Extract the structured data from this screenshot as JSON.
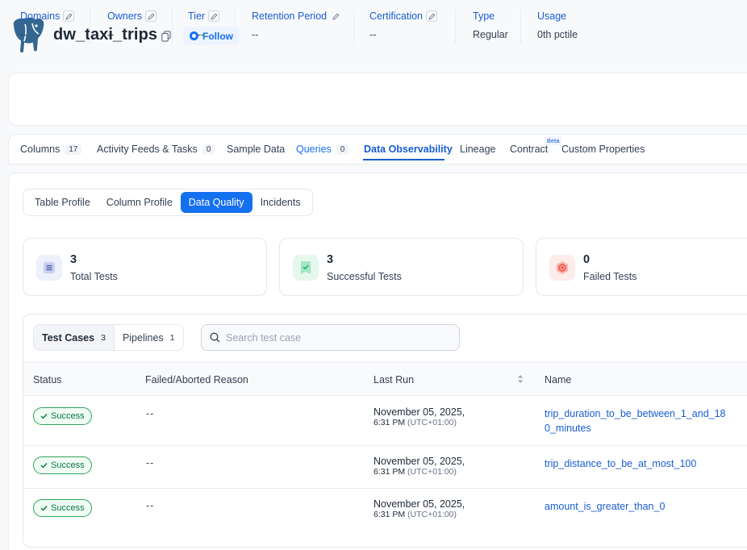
{
  "header": {
    "title": "dw_taxi_trips",
    "follow_label": "Follow",
    "logo_icon": "postgres-elephant-icon",
    "copy_icon": "copy-icon"
  },
  "properties": [
    {
      "label": "Domains",
      "value": "--",
      "editable": true
    },
    {
      "label": "Owners",
      "value": "--",
      "editable": true
    },
    {
      "label": "Tier",
      "value": "--",
      "editable": true
    },
    {
      "label": "Retention Period",
      "value": "--",
      "editable": true
    },
    {
      "label": "Certification",
      "value": "--",
      "editable": true
    },
    {
      "label": "Type",
      "value": "Regular",
      "editable": false
    },
    {
      "label": "Usage",
      "value": "0th pctile",
      "editable": false
    }
  ],
  "tabs": [
    {
      "label": "Columns",
      "count": "17"
    },
    {
      "label": "Activity Feeds & Tasks",
      "count": "0"
    },
    {
      "label": "Sample Data"
    },
    {
      "label": "Queries",
      "count": "0"
    },
    {
      "label": "Data Observability",
      "active": true
    },
    {
      "label": "Lineage"
    },
    {
      "label": "Contract",
      "badge": "Beta"
    },
    {
      "label": "Custom Properties"
    }
  ],
  "profile_tabs": [
    {
      "label": "Table Profile"
    },
    {
      "label": "Column Profile"
    },
    {
      "label": "Data Quality",
      "active": true
    },
    {
      "label": "Incidents"
    }
  ],
  "stats": [
    {
      "value": "3",
      "label": "Total Tests",
      "icon": "list-icon",
      "bg": "#eef1fb",
      "fg": "#4e5ba6"
    },
    {
      "value": "3",
      "label": "Successful Tests",
      "icon": "success-check-icon",
      "bg": "#e6f7ee",
      "fg": "#17b26a"
    },
    {
      "value": "0",
      "label": "Failed Tests",
      "icon": "failed-x-icon",
      "bg": "#fdecea",
      "fg": "#f04438"
    }
  ],
  "test_tabs": [
    {
      "label": "Test Cases",
      "count": "3",
      "active": true
    },
    {
      "label": "Pipelines",
      "count": "1"
    }
  ],
  "search": {
    "placeholder": "Search test case",
    "value": ""
  },
  "table": {
    "columns": [
      "Status",
      "Failed/Aborted Reason",
      "Last Run",
      "Name"
    ],
    "rows": [
      {
        "status": "Success",
        "reason": "--",
        "date": "November 05, 2025,",
        "time": "6:31 PM",
        "tz": "(UTC+01:00)",
        "name": "trip_duration_to_be_between_1_and_180_minutes"
      },
      {
        "status": "Success",
        "reason": "--",
        "date": "November 05, 2025,",
        "time": "6:31 PM",
        "tz": "(UTC+01:00)",
        "name": "trip_distance_to_be_at_most_100"
      },
      {
        "status": "Success",
        "reason": "--",
        "date": "November 05, 2025,",
        "time": "6:31 PM",
        "tz": "(UTC+01:00)",
        "name": "amount_is_greater_than_0"
      }
    ]
  },
  "colors": {
    "accent": "#1570ef",
    "link": "#175cd3",
    "success": "#067647"
  }
}
